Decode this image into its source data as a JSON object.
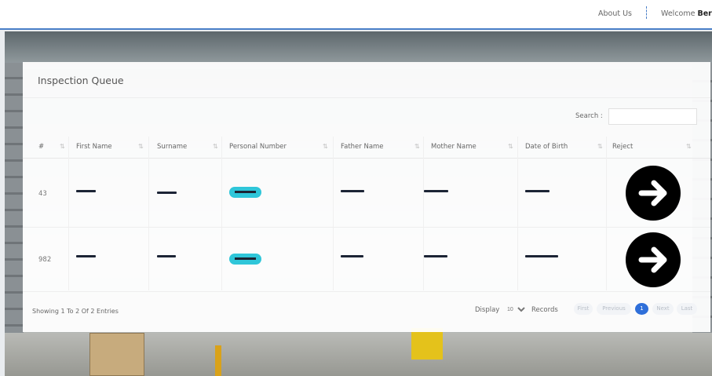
{
  "topbar": {
    "about_label": "About Us",
    "welcome_label": "Welcome",
    "user_name": "Berr"
  },
  "card": {
    "title": "Inspection Queue",
    "search_label": "Search :",
    "search_value": ""
  },
  "table": {
    "columns": [
      "#",
      "First Name",
      "Surname",
      "Personal Number",
      "Father Name",
      "Mother Name",
      "Date of Birth",
      "Reject"
    ],
    "rows": [
      {
        "id": "43"
      },
      {
        "id": "982"
      }
    ]
  },
  "footer": {
    "entries_info": "Showing 1 To 2 Of 2 Entries",
    "display_label": "Display",
    "page_length": "10",
    "records_label": "Records",
    "pagination": [
      "First",
      "Previous",
      "1",
      "Next",
      "Last"
    ]
  },
  "colors": {
    "accent": "#2f6fd9",
    "pill": "#2fc6d9",
    "nav_border": "#4a7fc8"
  },
  "icons": {
    "reject": "arrow-right-circle-icon"
  }
}
